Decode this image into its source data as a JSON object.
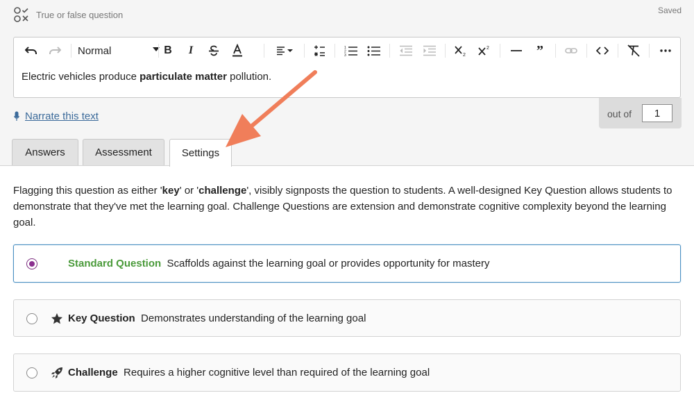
{
  "header": {
    "question_type": "True or false question",
    "save_status": "Saved",
    "qtype_icon": "check-cross-icon"
  },
  "editor": {
    "style_select": "Normal",
    "toolbar_icons": [
      "undo-icon",
      "redo-icon",
      "bold-icon",
      "italic-icon",
      "strikethrough-icon",
      "text-color-icon",
      "align-icon",
      "formula-icon",
      "numbered-list-icon",
      "bullet-list-icon",
      "outdent-icon",
      "indent-icon",
      "subscript-icon",
      "superscript-icon",
      "horizontal-rule-icon",
      "blockquote-icon",
      "link-icon",
      "code-icon",
      "clear-format-icon",
      "more-icon"
    ],
    "content_before": "Electric vehicles produce ",
    "content_bold": "particulate matter",
    "content_after": " pollution."
  },
  "narrate": {
    "label": "Narrate this text",
    "icon": "microphone-icon"
  },
  "score": {
    "label": "out of",
    "value": "1"
  },
  "tabs": [
    {
      "label": "Answers"
    },
    {
      "label": "Assessment"
    },
    {
      "label": "Settings",
      "active": true
    }
  ],
  "settings": {
    "desc_1": "Flagging this question as either '",
    "desc_key": "key",
    "desc_2": "' or '",
    "desc_challenge": "challenge",
    "desc_3": "', visibly signposts the question to students. A well-designed Key Question allows students to demonstrate that they've met the learning goal. Challenge Questions are extension and demonstrate cognitive complexity beyond the learning goal.",
    "options": [
      {
        "title": "Standard Question",
        "desc": "Scaffolds against the learning goal or provides opportunity for mastery",
        "selected": true
      },
      {
        "title": "Key Question",
        "desc": "Demonstrates understanding of the learning goal",
        "icon": "star-icon"
      },
      {
        "title": "Challenge",
        "desc": "Requires a higher cognitive level than required of the learning goal",
        "icon": "rocket-icon"
      }
    ]
  },
  "colors": {
    "accent_blue": "#4a90c2",
    "standard_green": "#4a9a3a",
    "radio_purple": "#8b2f8f",
    "annotation_arrow": "#f07e5a"
  }
}
